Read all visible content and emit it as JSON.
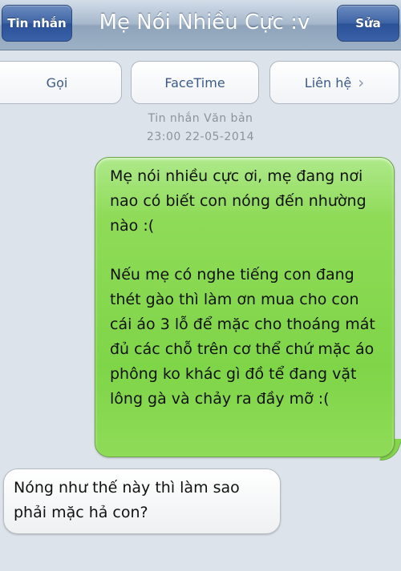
{
  "navbar": {
    "back_label": "Tin nhắn",
    "title": "Mẹ Nói Nhiều Cực :v",
    "edit_label": "Sửa"
  },
  "actions": {
    "call_label": "Gọi",
    "facetime_label": "FaceTime",
    "contact_label": "Liên hệ",
    "chevron": "›"
  },
  "conversation": {
    "type_label": "Tin nhắn Văn bản",
    "timestamp": "23:00 22-05-2014"
  },
  "messages": {
    "outgoing": {
      "paragraph1": "Mẹ nói nhiều cực ơi, mẹ đang nơi nao có biết con nóng đến nhường nào :(",
      "paragraph2": "Nếu mẹ có nghe tiếng con đang thét gào thì làm ơn mua cho con cái áo 3 lỗ để mặc cho thoáng mát đủ các chỗ trên cơ thể chứ mặc áo phông ko khác gì đồ tể đang vặt lông gà và chảy ra đầy mỡ :("
    },
    "incoming": {
      "text": "Nóng như thế này thì làm sao phải mặc hả con?"
    }
  },
  "colors": {
    "outgoing_bubble": "#7fd548",
    "nav_button": "#3e64a6",
    "action_text": "#3d5a87"
  }
}
